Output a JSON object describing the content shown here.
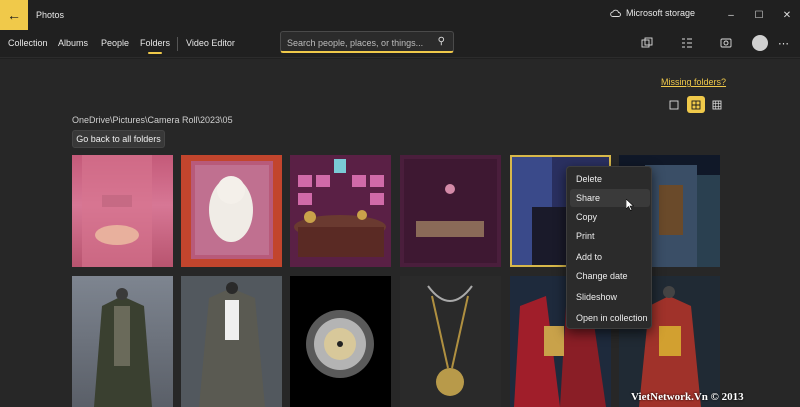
{
  "titlebar": {
    "app_title": "Photos",
    "storage_label": "Microsoft storage"
  },
  "nav": {
    "tabs": [
      "Collection",
      "Albums",
      "People",
      "Folders",
      "Video Editor"
    ],
    "active": "Folders"
  },
  "search": {
    "placeholder": "Search people, places, or things..."
  },
  "main": {
    "missing_link": "Missing folders?",
    "path": "OneDrive\\Pictures\\Camera Roll\\2023\\05",
    "go_back": "Go back to all folders"
  },
  "context_menu": {
    "items": [
      "Delete",
      "Share",
      "Copy",
      "Print",
      "Add to",
      "Change date",
      "Slideshow",
      "Open in collection"
    ],
    "hovered": "Share"
  },
  "watermark": "VietNetwork.Vn © 2013",
  "colors": {
    "accent": "#f0c94a",
    "background": "#202020",
    "panel": "#272727"
  },
  "icons": [
    "back-arrow-icon",
    "cloud-icon",
    "minimize-icon",
    "maximize-icon",
    "close-icon",
    "search-icon",
    "import-icon",
    "select-icon",
    "edit-icon",
    "more-icon",
    "single-view-icon",
    "medium-grid-icon",
    "small-grid-icon"
  ]
}
